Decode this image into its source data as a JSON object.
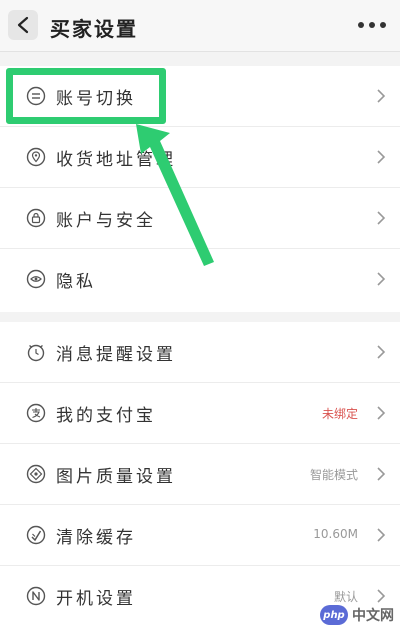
{
  "header": {
    "title": "买家设置",
    "back_icon": "chevron-left-icon",
    "more_icon": "more-dots-icon"
  },
  "groups": [
    {
      "items": [
        {
          "label": "账号切换",
          "icon": "switch-account-icon",
          "value": ""
        },
        {
          "label": "收货地址管理",
          "icon": "location-pin-icon",
          "value": ""
        },
        {
          "label": "账户与安全",
          "icon": "lock-icon",
          "value": ""
        },
        {
          "label": "隐私",
          "icon": "privacy-eye-icon",
          "value": ""
        }
      ]
    },
    {
      "items": [
        {
          "label": "消息提醒设置",
          "icon": "alarm-clock-icon",
          "value": ""
        },
        {
          "label": "我的支付宝",
          "icon": "alipay-icon",
          "value": "未绑定",
          "value_color": "#d9534f"
        },
        {
          "label": "图片质量设置",
          "icon": "image-quality-icon",
          "value": "智能模式"
        },
        {
          "label": "清除缓存",
          "icon": "clear-cache-icon",
          "value": "10.60M"
        },
        {
          "label": "开机设置",
          "icon": "startup-n-icon",
          "value": "默认"
        }
      ]
    }
  ],
  "annotation": {
    "highlight_color": "#2ecc71"
  },
  "watermark": {
    "logo": "php",
    "text": "中文网"
  }
}
